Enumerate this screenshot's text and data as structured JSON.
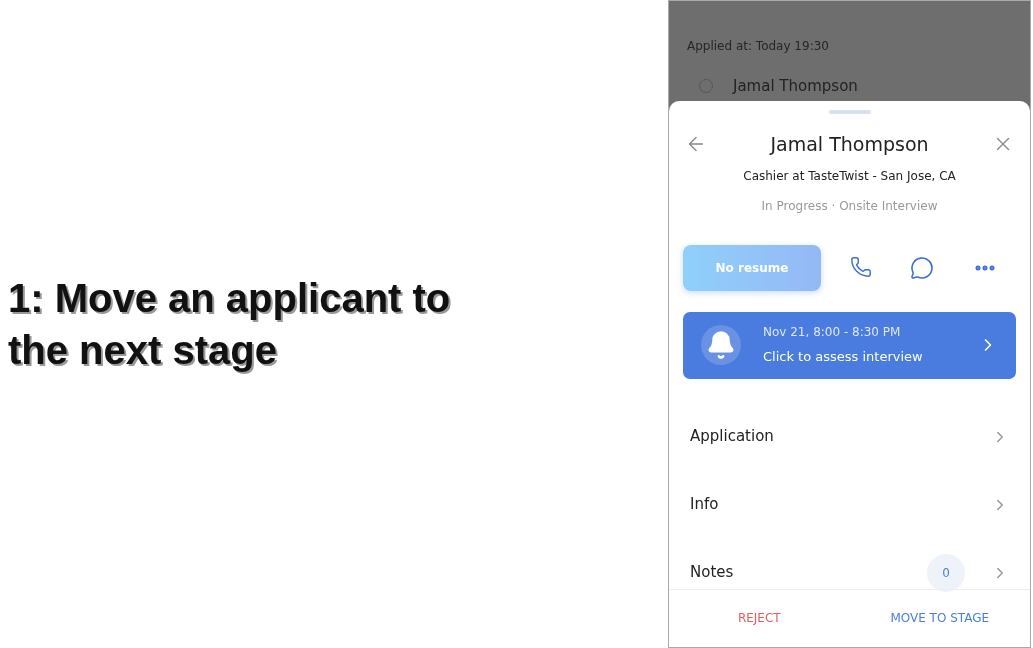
{
  "caption": "1: Move an applicant to the next stage",
  "background": {
    "applied_at": "Applied at: Today 19:30",
    "name": "Jamal Thompson"
  },
  "sheet": {
    "title": "Jamal Thompson",
    "subtitle": "Cashier at TasteTwist - San Jose, CA",
    "status": "In Progress · Onsite Interview",
    "resume_button": "No resume",
    "interview": {
      "time": "Nov 21, 8:00 - 8:30 PM",
      "action": "Click to assess interview"
    },
    "sections": [
      {
        "label": "Application"
      },
      {
        "label": "Info"
      },
      {
        "label": "Notes",
        "count": "0"
      }
    ],
    "actions": [
      {
        "label": "REJECT",
        "kind": "danger"
      },
      {
        "label": "MOVE TO STAGE",
        "kind": "primary"
      }
    ]
  }
}
